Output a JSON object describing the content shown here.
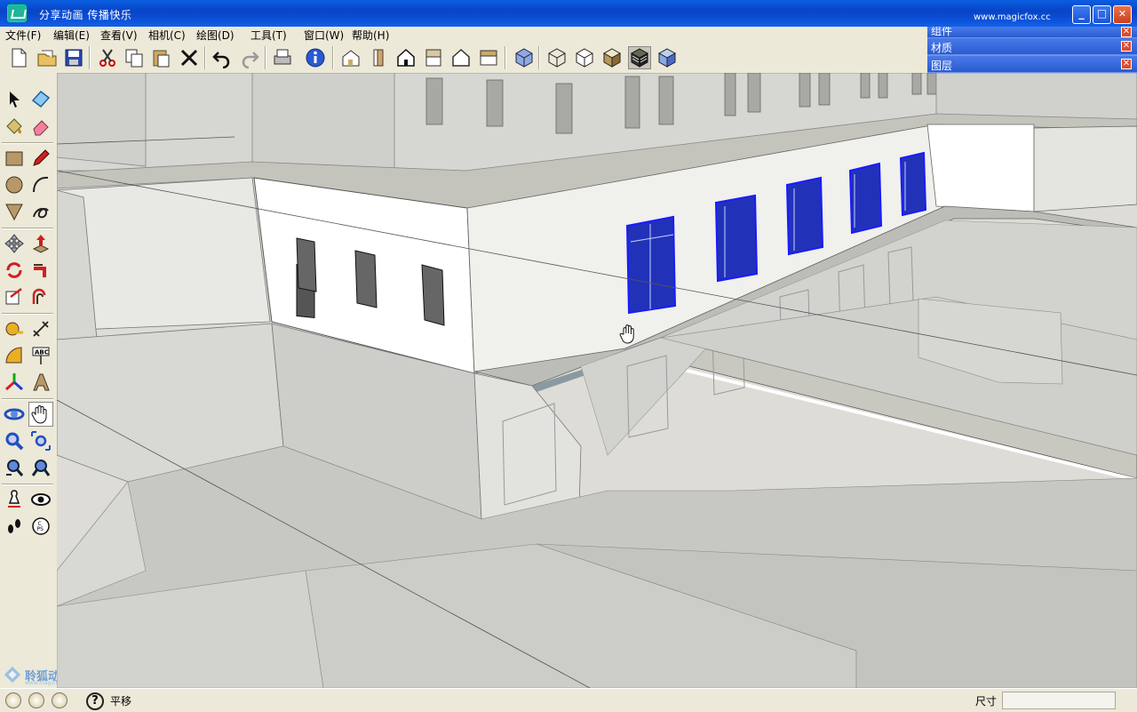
{
  "window": {
    "title": "分享动画  传播快乐",
    "url": "www.magicfox.cc",
    "minimize": "_",
    "maximize": "□",
    "close": "✕"
  },
  "menu": [
    "文件(F)",
    "编辑(E)",
    "查看(V)",
    "相机(C)",
    "绘图(D)",
    "工具(T)",
    "窗口(W)",
    "帮助(H)"
  ],
  "trays": [
    {
      "label": "组件"
    },
    {
      "label": "材质"
    },
    {
      "label": "图层"
    }
  ],
  "toolbar_icons": [
    "new-icon",
    "open-icon",
    "save-icon",
    "cut-icon",
    "copy-icon",
    "paste-icon",
    "erase-icon",
    "undo-icon",
    "redo-icon",
    "print-icon",
    "model-info-icon",
    "iso-view-icon",
    "front-view-icon",
    "home-view-icon",
    "top-view-icon",
    "right-view-icon",
    "back-view-icon",
    "xray-icon",
    "wireframe-icon",
    "hidden-line-icon",
    "shaded-icon",
    "shaded-texture-icon",
    "monochrome-icon"
  ],
  "left_tools": [
    "select-icon",
    "component-icon",
    "paint-bucket-icon",
    "eraser-icon",
    "rectangle-icon",
    "pencil-icon",
    "circle-icon",
    "arc-icon",
    "polygon-icon",
    "freehand-icon",
    "move-icon",
    "push-pull-icon",
    "rotate-icon",
    "follow-me-icon",
    "scale-icon",
    "offset-icon",
    "tape-measure-icon",
    "dimension-icon",
    "protractor-icon",
    "text-icon",
    "axes-icon",
    "3d-text-icon",
    "orbit-icon",
    "pan-icon",
    "zoom-icon",
    "zoom-window-icon",
    "previous-view-icon",
    "zoom-extents-icon",
    "position-camera-icon",
    "look-around-icon",
    "walk-icon",
    "section-plane-icon"
  ],
  "watermark": {
    "text": "聆狐动画",
    "sub": "www.magicfox.cc"
  },
  "status": {
    "hint": "平移",
    "help": "?",
    "measure_label": "尺寸",
    "measure_value": ""
  },
  "colors": {
    "selection": "#1a1aff",
    "titlebar": "#0a4ad0"
  }
}
